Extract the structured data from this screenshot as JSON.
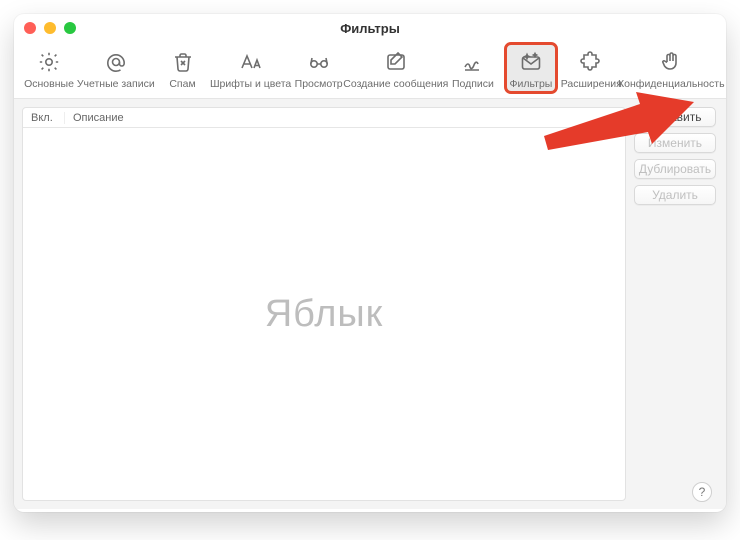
{
  "window": {
    "title": "Фильтры"
  },
  "toolbar": {
    "items": [
      {
        "id": "general",
        "label": "Основные"
      },
      {
        "id": "accounts",
        "label": "Учетные записи"
      },
      {
        "id": "junk",
        "label": "Спам"
      },
      {
        "id": "fonts",
        "label": "Шрифты и цвета"
      },
      {
        "id": "viewing",
        "label": "Просмотр"
      },
      {
        "id": "compose",
        "label": "Создание сообщения"
      },
      {
        "id": "signatures",
        "label": "Подписи"
      },
      {
        "id": "rules",
        "label": "Фильтры",
        "selected": true
      },
      {
        "id": "extensions",
        "label": "Расширения"
      },
      {
        "id": "privacy",
        "label": "Конфиденциальность"
      }
    ]
  },
  "list": {
    "columns": {
      "on": "Вкл.",
      "desc": "Описание"
    },
    "rows": []
  },
  "sideButtons": {
    "add": "Добавить",
    "edit": "Изменить",
    "duplicate": "Дублировать",
    "delete": "Удалить"
  },
  "watermark": "Яблык",
  "help": "?",
  "annotation": {
    "arrowColor": "#e53b2a"
  }
}
